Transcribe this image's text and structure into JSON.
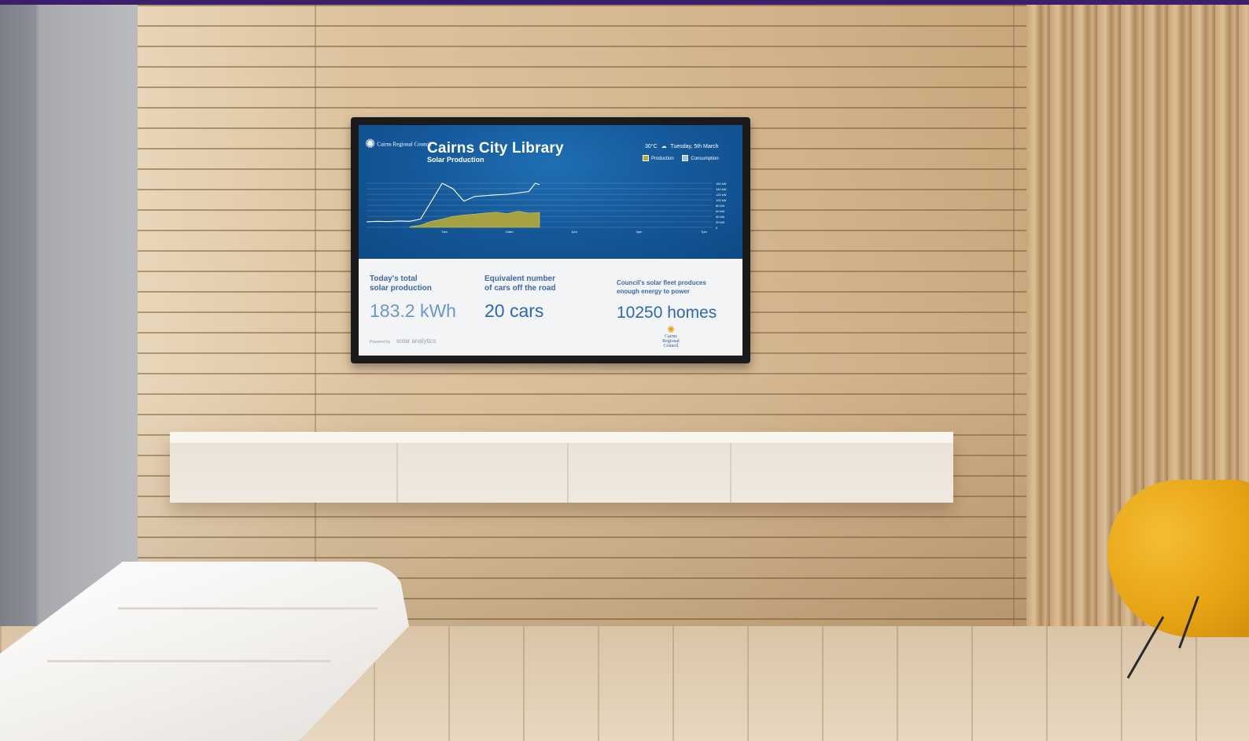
{
  "display": {
    "org_logo_text": "Cairns Regional Council",
    "title": "Cairns City Library",
    "subtitle": "Solar Production",
    "weather": {
      "temperature": "30°C",
      "date": "Tuesday, 5th March"
    },
    "legend": [
      {
        "label": "Production",
        "color": "#b5a93a"
      },
      {
        "label": "Consumption",
        "color": "#9ec6ea"
      }
    ],
    "colors": {
      "hero": "#155a9b",
      "accent": "#2f68b2",
      "production": "#b5a93a",
      "consumption_line": "#ffffff"
    }
  },
  "chart_data": {
    "type": "area",
    "x_ticks": [
      "7am",
      "10am",
      "1pm",
      "4pm",
      "7pm"
    ],
    "y_ticks": [
      "160 kW",
      "140 kW",
      "120 kW",
      "100 kW",
      "80 kW",
      "60 kW",
      "40 kW",
      "20 kW",
      "0"
    ],
    "ylim": [
      0,
      160
    ],
    "series": [
      {
        "name": "Consumption",
        "type": "line",
        "x": [
          5.0,
          5.5,
          6.0,
          6.5,
          7.0,
          7.5,
          8.0,
          8.5,
          9.0,
          9.5,
          10.0,
          10.5,
          11.0,
          11.5,
          12.0,
          12.5,
          12.8,
          13.0
        ],
        "values": [
          20,
          22,
          21,
          23,
          22,
          30,
          95,
          160,
          140,
          95,
          112,
          115,
          118,
          120,
          125,
          130,
          165,
          155
        ]
      },
      {
        "name": "Production",
        "type": "area",
        "x": [
          7.0,
          7.5,
          8.0,
          8.5,
          9.0,
          9.5,
          10.0,
          10.5,
          11.0,
          11.5,
          12.0,
          12.5,
          13.0
        ],
        "values": [
          2,
          8,
          22,
          30,
          40,
          45,
          48,
          52,
          55,
          50,
          58,
          52,
          54
        ]
      }
    ]
  },
  "stats": [
    {
      "label_line1": "Today's total",
      "label_line2": "solar production",
      "value": "183.2 kWh"
    },
    {
      "label_line1": "Equivalent number",
      "label_line2": "of cars off the road",
      "value": "20 cars"
    },
    {
      "label_line1": "Council's solar fleet produces",
      "label_line2": "enough energy to power",
      "value": "10250 homes"
    }
  ],
  "footer": {
    "powered_by": "Powered by",
    "brand": "solar analytics",
    "logo_small": "Cairns Regional Council"
  }
}
